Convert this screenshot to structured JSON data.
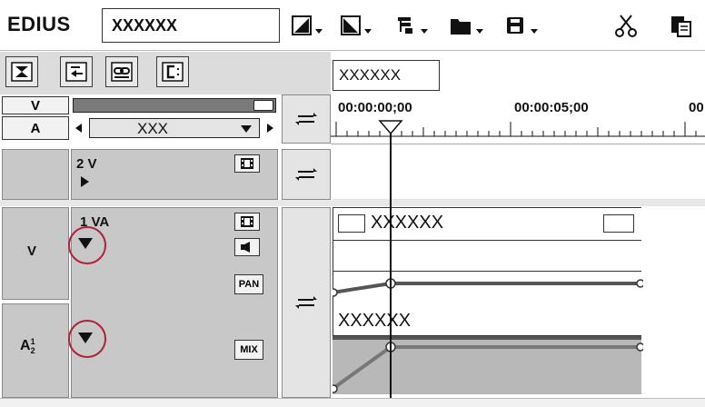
{
  "app": {
    "title": "EDIUS",
    "project_name": "XXXXXX"
  },
  "toolbar": {
    "icons": [
      "set-in-icon",
      "set-out-icon",
      "sequence-icon",
      "open-folder-icon",
      "save-icon",
      "cut-icon",
      "paste-icon"
    ]
  },
  "controls": {
    "sequence_tab": "XXXXXX",
    "v_label": "V",
    "a_label": "A",
    "channel_select": "XXX"
  },
  "timeline": {
    "timecodes": [
      "00:00:00;00",
      "00:00:05;00",
      "00"
    ]
  },
  "tracks": {
    "track2": {
      "name": "2 V"
    },
    "track1": {
      "name": "1 VA",
      "v_label": "V",
      "a_label_main": "A",
      "a_sup": "1",
      "a_sub": "2",
      "pan_label": "PAN",
      "mix_label": "MIX"
    }
  },
  "clips": {
    "video_clip_name": "XXXXXX",
    "audio_clip_name": "XXXXXX"
  }
}
